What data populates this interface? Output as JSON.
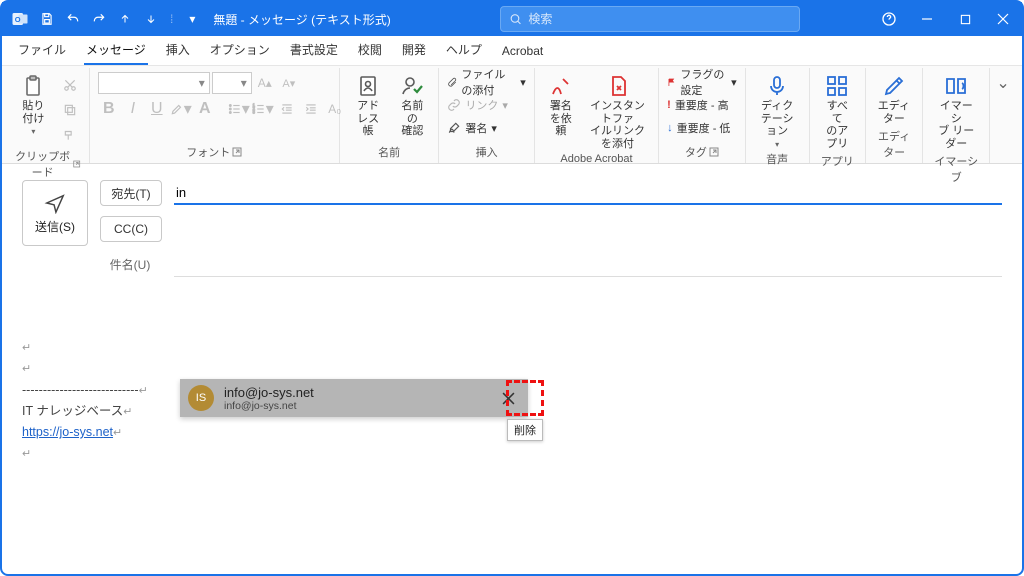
{
  "title": "無題 - メッセージ (テキスト形式)",
  "search_placeholder": "検索",
  "menus": [
    "ファイル",
    "メッセージ",
    "挿入",
    "オプション",
    "書式設定",
    "校閲",
    "開発",
    "ヘルプ",
    "Acrobat"
  ],
  "active_menu": 1,
  "ribbon": {
    "clipboard": {
      "paste": "貼り付け",
      "label": "クリップボード"
    },
    "font": {
      "label": "フォント",
      "bold": "B",
      "italic": "I",
      "underline": "U"
    },
    "names": {
      "address": "アドレス帳",
      "check": "名前の\n確認",
      "label": "名前"
    },
    "insert": {
      "attach": "ファイルの添付",
      "link": "リンク",
      "sign": "署名",
      "label": "挿入"
    },
    "acrobat": {
      "req": "署名\nを依頼",
      "instant": "インスタントファ\nイルリンクを添付",
      "label": "Adobe Acrobat"
    },
    "tags": {
      "flag": "フラグの設定",
      "hi": "重要度 - 高",
      "lo": "重要度 - 低",
      "label": "タグ"
    },
    "voice": {
      "dict": "ディク\nテーション",
      "label": "音声"
    },
    "apps": {
      "all": "すべて\nのアプリ",
      "label": "アプリ"
    },
    "editor": {
      "ed": "エディ\nター",
      "label": "エディター"
    },
    "immersive": {
      "ir": "イマーシ\nブ リーダー",
      "label": "イマーシブ"
    }
  },
  "compose": {
    "send": "送信(S)",
    "to_btn": "宛先(T)",
    "cc_btn": "CC(C)",
    "subject_label": "件名(U)",
    "to_value": "in"
  },
  "suggestion": {
    "initials": "IS",
    "name": "info@jo-sys.net",
    "email": "info@jo-sys.net",
    "delete_tooltip": "削除"
  },
  "body": {
    "divider": "----------------------------",
    "sig1": "IT ナレッジベース",
    "sig2": "https://jo-sys.net"
  }
}
